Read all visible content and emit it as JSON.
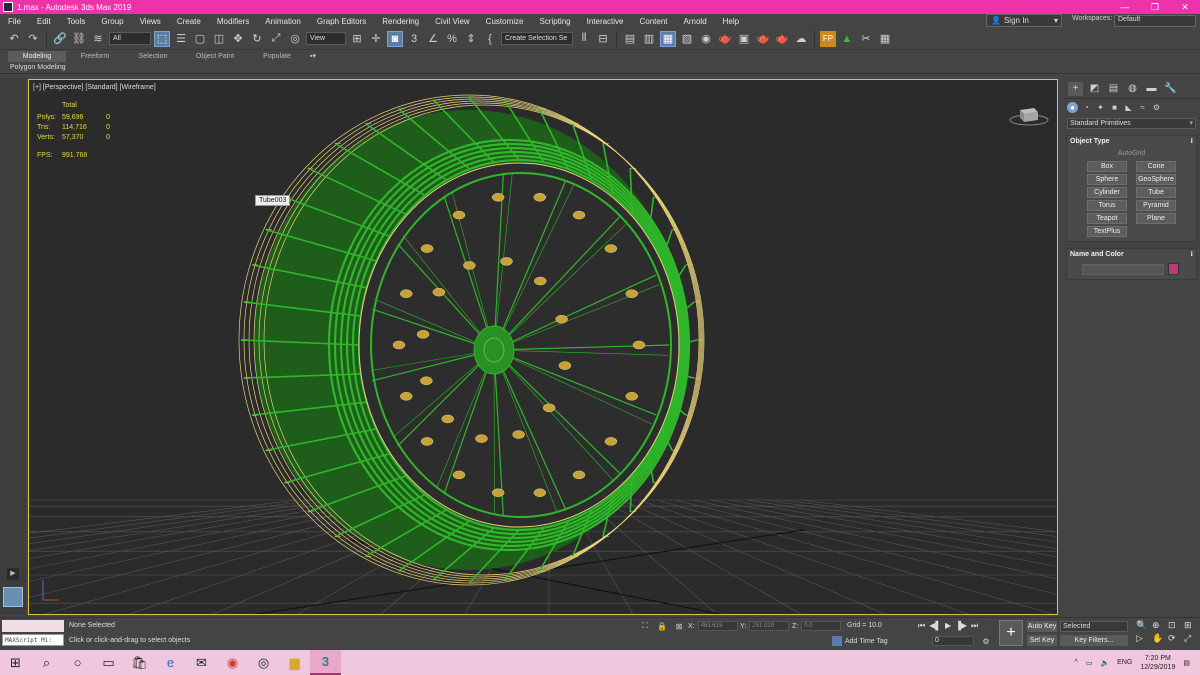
{
  "window": {
    "title": "1.max - Autodesk 3ds Max 2019",
    "controls": [
      "—",
      "❐",
      "✕"
    ]
  },
  "menu": {
    "items": [
      "File",
      "Edit",
      "Tools",
      "Group",
      "Views",
      "Create",
      "Modifiers",
      "Animation",
      "Graph Editors",
      "Rendering",
      "Civil View",
      "Customize",
      "Scripting",
      "Interactive",
      "Content",
      "Arnold",
      "Help"
    ],
    "sign_in": "Sign In",
    "workspaces_label": "Workspaces:",
    "workspace_value": "Default"
  },
  "toolbar": {
    "filter_value": "All",
    "refcoord_value": "View",
    "selection_set_placeholder": "Create Selection Se"
  },
  "ribbon": {
    "tabs": [
      "Modeling",
      "Freeform",
      "Selection",
      "Object Paint",
      "Populate"
    ],
    "sub_label": "Polygon Modeling"
  },
  "viewport": {
    "label": "[+] [Perspective] [Standard] [Wireframe]",
    "stats": {
      "header": "Total",
      "rows": [
        {
          "label": "Polys:",
          "total": "59,696",
          "sel": "0"
        },
        {
          "label": "Tris:",
          "total": "114,716",
          "sel": "0"
        },
        {
          "label": "Verts:",
          "total": "57,370",
          "sel": "0"
        }
      ],
      "fps_label": "FPS:",
      "fps_value": "991.768"
    },
    "tooltip": "Tube003",
    "colors": {
      "wire_yellow": "#e8d27a",
      "mesh_green": "#2fb62a",
      "grid": "#555555",
      "border": "#d7c83a"
    }
  },
  "command_panel": {
    "category": "Standard Primitives",
    "object_type_title": "Object Type",
    "autogrid": "AutoGrid",
    "primitives": [
      "Box",
      "Cone",
      "Sphere",
      "GeoSphere",
      "Cylinder",
      "Tube",
      "Torus",
      "Pyramid",
      "Teapot",
      "Plane",
      "TextPlus"
    ],
    "name_color_title": "Name and Color",
    "object_color": "#c03875"
  },
  "status": {
    "maxscript": "MAXScript Mi:",
    "selection": "None Selected",
    "prompt": "Click or click-and-drag to select objects",
    "x_label": "X:",
    "x_value": "463.619",
    "y_label": "Y:",
    "y_value": "251.029",
    "z_label": "Z:",
    "z_value": "0.0",
    "grid": "Grid = 10.0",
    "add_time_tag": "Add Time Tag",
    "frame": "0",
    "auto_key": "Auto Key",
    "set_key": "Set Key",
    "selected_dd": "Selected",
    "key_filters": "Key Filters..."
  },
  "taskbar": {
    "lang": "ENG",
    "time": "7:20 PM",
    "date": "12/29/2019"
  }
}
